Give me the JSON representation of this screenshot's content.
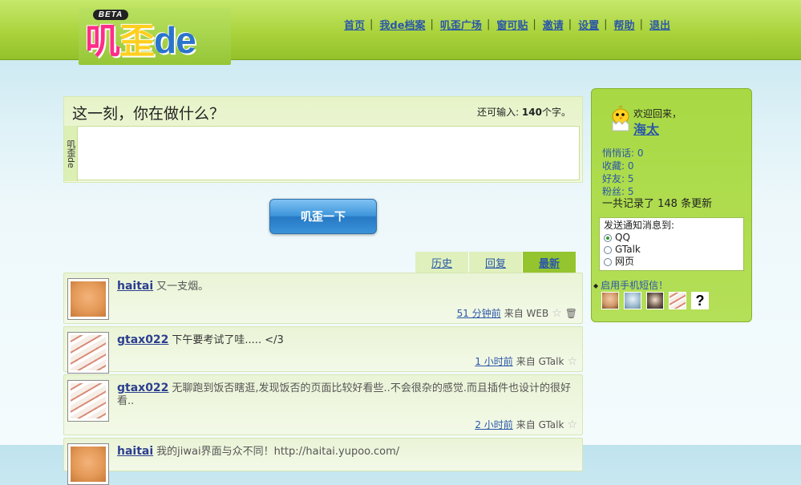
{
  "brand": {
    "beta": "BETA",
    "logo_part1": "叽",
    "logo_part2": "歪",
    "logo_part3": "de"
  },
  "nav": [
    "首页",
    "我de档案",
    "叽歪广场",
    "窗可贴",
    "邀请",
    "设置",
    "帮助",
    "退出"
  ],
  "compose": {
    "title": "这一刻，你在做什么？",
    "count_prefix": "还可输入: ",
    "count_value": "140",
    "count_suffix": "个字。",
    "side_label": "叽歪de",
    "submit": "叽歪一下"
  },
  "tabs": [
    "历史",
    "回复",
    "最新"
  ],
  "feed": [
    {
      "user": "haitai",
      "text": "又一支烟。",
      "time": "51 分钟前",
      "source": "来自 WEB"
    },
    {
      "user": "gtax022",
      "text": "下午要考试了哇..... </3",
      "time": "1 小时前",
      "source": "来自 GTalk"
    },
    {
      "user": "gtax022",
      "text": "无聊跑到饭否瞎逛,发现饭否的页面比较好看些..不会很杂的感觉.而且插件也设计的很好看..",
      "time": "2 小时前",
      "source": "来自 GTalk"
    },
    {
      "user": "haitai",
      "text": "我的jiwai界面与众不同！http://haitai.yupoo.com/",
      "time": "",
      "source": ""
    }
  ],
  "sidebar": {
    "welcome": "欢迎回来，",
    "username": "海太",
    "stats": [
      "悄悄话: 0",
      "收藏: 0",
      "好友: 5",
      "粉丝: 5"
    ],
    "total": "一共记录了 148 条更新",
    "notify_title": "发送通知消息到:",
    "notify_options": [
      "QQ",
      "GTalk",
      "网页"
    ],
    "sms": "启用手机短信！",
    "unknown_friend": "?"
  }
}
